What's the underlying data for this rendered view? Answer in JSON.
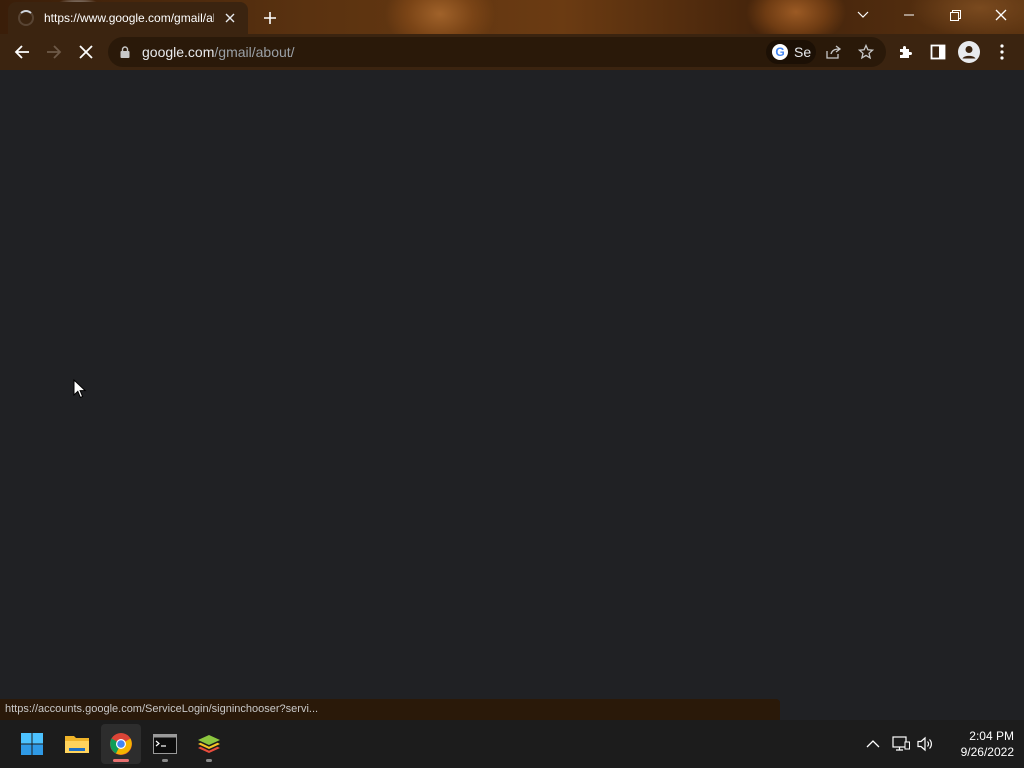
{
  "browser": {
    "tab": {
      "title": "https://www.google.com/gmail/about/",
      "close_icon": "close-icon"
    },
    "new_tab_icon": "plus-icon",
    "window_controls": {
      "tab_search_icon": "chevron-down-icon",
      "minimize_icon": "minimize-icon",
      "restore_icon": "restore-icon",
      "close_icon": "close-icon"
    },
    "toolbar": {
      "back_icon": "arrow-left-icon",
      "forward_icon": "arrow-right-icon",
      "stop_icon": "close-icon"
    },
    "omnibox": {
      "lock_icon": "lock-icon",
      "host": "google.com",
      "path": "/gmail/about/",
      "search_chip_text": "Se",
      "share_icon": "share-icon",
      "bookmark_icon": "star-icon"
    },
    "extensions_icon": "puzzle-icon",
    "side_panel_icon": "side-panel-icon",
    "profile_icon": "person-icon",
    "menu_icon": "kebab-menu-icon"
  },
  "status_bar": {
    "url": "https://accounts.google.com/ServiceLogin/signinchooser?servi..."
  },
  "taskbar": {
    "apps": [
      {
        "name": "start",
        "icon": "windows-logo-icon"
      },
      {
        "name": "file-explorer",
        "icon": "folder-icon"
      },
      {
        "name": "chrome",
        "icon": "chrome-icon",
        "active": true
      },
      {
        "name": "terminal",
        "icon": "terminal-icon"
      },
      {
        "name": "bluestacks",
        "icon": "layers-icon"
      }
    ],
    "tray": {
      "chevron_icon": "chevron-up-icon",
      "network_icon": "network-icon",
      "volume_icon": "speaker-icon"
    },
    "clock": {
      "time": "2:04 PM",
      "date": "9/26/2022"
    }
  },
  "colors": {
    "frame": "#3b2410",
    "page_background": "#202124",
    "taskbar": "#1c1c1c",
    "active_indicator": "#e86f6f"
  }
}
